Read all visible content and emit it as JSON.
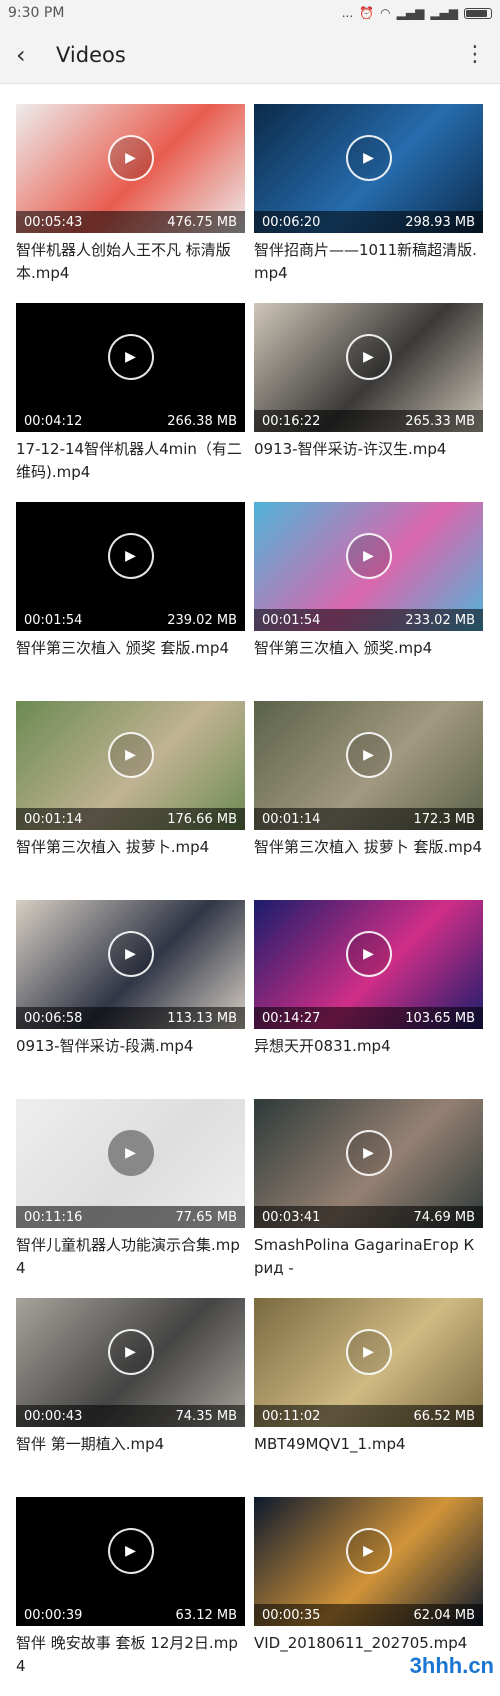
{
  "status_bar": {
    "time": "9:30 PM",
    "signal": "...",
    "icons": "alarm wifi signal signal battery"
  },
  "app_bar": {
    "back_icon": "‹",
    "title": "Videos",
    "more_icon": "⋮"
  },
  "videos": [
    {
      "duration": "00:05:43",
      "size": "476.75 MB",
      "name": "智伴机器人创始人王不凡 标清版本.mp4",
      "bg": "#ededed",
      "accent": "#e84c3d",
      "grey_play": false
    },
    {
      "duration": "00:06:20",
      "size": "298.93 MB",
      "name": "智伴招商片——1011新稿超清版.mp4",
      "bg": "#0b2a4a",
      "accent": "#2a74b9",
      "grey_play": false
    },
    {
      "duration": "00:04:12",
      "size": "266.38 MB",
      "name": "17-12-14智伴机器人4min（有二维码).mp4",
      "bg": "#000000",
      "accent": "#000000",
      "grey_play": false
    },
    {
      "duration": "00:16:22",
      "size": "265.33 MB",
      "name": "0913-智伴采访-许汉生.mp4",
      "bg": "#cfc6b8",
      "accent": "#2a2a2a",
      "grey_play": false
    },
    {
      "duration": "00:01:54",
      "size": "239.02 MB",
      "name": "智伴第三次植入 颁奖 套版.mp4",
      "bg": "#000000",
      "accent": "#000000",
      "grey_play": false
    },
    {
      "duration": "00:01:54",
      "size": "233.02 MB",
      "name": "智伴第三次植入 颁奖.mp4",
      "bg": "#4fb4d8",
      "accent": "#e85fa8",
      "grey_play": false
    },
    {
      "duration": "00:01:14",
      "size": "176.66 MB",
      "name": "智伴第三次植入 拔萝卜.mp4",
      "bg": "#6c8a52",
      "accent": "#c9b79a",
      "grey_play": false
    },
    {
      "duration": "00:01:14",
      "size": "172.3 MB",
      "name": "智伴第三次植入 拔萝卜 套版.mp4",
      "bg": "#5a6248",
      "accent": "#a99f86",
      "grey_play": false
    },
    {
      "duration": "00:06:58",
      "size": "113.13 MB",
      "name": "0913-智伴采访-段满.mp4",
      "bg": "#d7cfc4",
      "accent": "#1e2538",
      "grey_play": false
    },
    {
      "duration": "00:14:27",
      "size": "103.65 MB",
      "name": "异想天开0831.mp4",
      "bg": "#1a1d6b",
      "accent": "#e4308a",
      "grey_play": false
    },
    {
      "duration": "00:11:16",
      "size": "77.65 MB",
      "name": "智伴儿童机器人功能演示合集.mp4",
      "bg": "#eeeeee",
      "accent": "#dcdcdc",
      "grey_play": true
    },
    {
      "duration": "00:03:41",
      "size": "74.69 MB",
      "name": "SmashPolina GagarinaЕгор Крид - ",
      "bg": "#2e3a3a",
      "accent": "#a08878",
      "grey_play": false
    },
    {
      "duration": "00:00:43",
      "size": "74.35 MB",
      "name": "智伴 第一期植入.mp4",
      "bg": "#a7a39c",
      "accent": "#3a3a3a",
      "grey_play": false
    },
    {
      "duration": "00:11:02",
      "size": "66.52 MB",
      "name": "MBT49MQV1_1.mp4",
      "bg": "#7a6a40",
      "accent": "#d9c28a",
      "grey_play": false
    },
    {
      "duration": "00:00:39",
      "size": "63.12 MB",
      "name": "智伴 晚安故事 套板 12月2日.mp4",
      "bg": "#000000",
      "accent": "#000000",
      "grey_play": false
    },
    {
      "duration": "00:00:35",
      "size": "62.04 MB",
      "name": "VID_20180611_202705.mp4",
      "bg": "#0d1a2e",
      "accent": "#e7a23a",
      "grey_play": false
    }
  ],
  "watermark": "3hhh.cn",
  "icons": {
    "play": "play-icon",
    "back": "back-arrow-icon",
    "more": "more-vert-icon"
  }
}
